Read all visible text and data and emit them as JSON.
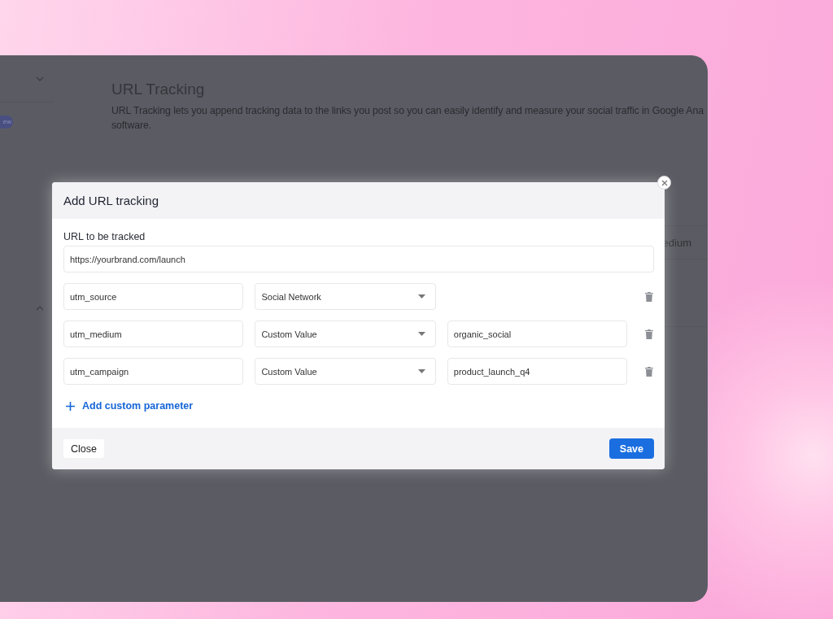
{
  "background_app": {
    "badge": "ew",
    "title": "URL Tracking",
    "description": "URL Tracking lets you append tracking data to the links you post so you can easily identify and measure your social traffic in Google Ana\nsoftware.",
    "column_header": "edium"
  },
  "modal": {
    "title": "Add URL tracking",
    "url_label": "URL to be tracked",
    "url_value": "https://yourbrand.com/launch",
    "parameters": [
      {
        "name": "utm_source",
        "source": "Social Network"
      },
      {
        "name": "utm_medium",
        "source": "Custom Value",
        "value": "organic_social"
      },
      {
        "name": "utm_campaign",
        "source": "Custom Value",
        "value": "product_launch_q4"
      }
    ],
    "add_label": "Add custom parameter",
    "close_label": "Close",
    "save_label": "Save"
  }
}
